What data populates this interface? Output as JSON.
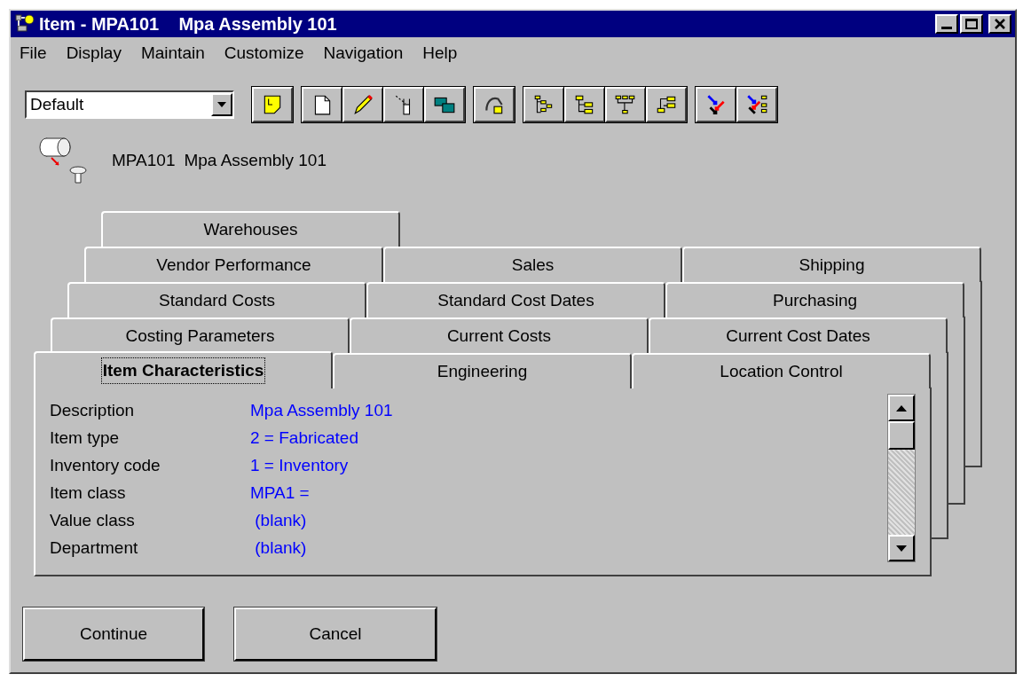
{
  "window": {
    "title": "Item - MPA101    Mpa Assembly 101"
  },
  "menu": [
    "File",
    "Display",
    "Maintain",
    "Customize",
    "Navigation",
    "Help"
  ],
  "view_select": {
    "value": "Default"
  },
  "item_header": {
    "code": "MPA101",
    "name": "Mpa Assembly 101"
  },
  "tab_rows": [
    [
      {
        "label": "Warehouses",
        "selected": false
      }
    ],
    [
      {
        "label": "Vendor Performance",
        "selected": false
      },
      {
        "label": "Sales",
        "selected": false
      },
      {
        "label": "Shipping",
        "selected": false
      }
    ],
    [
      {
        "label": "Standard Costs",
        "selected": false
      },
      {
        "label": "Standard Cost Dates",
        "selected": false
      },
      {
        "label": "Purchasing",
        "selected": false
      }
    ],
    [
      {
        "label": "Costing Parameters",
        "selected": false
      },
      {
        "label": "Current Costs",
        "selected": false
      },
      {
        "label": "Current Cost Dates",
        "selected": false
      }
    ],
    [
      {
        "label": "Item Characteristics",
        "selected": true
      },
      {
        "label": "Engineering",
        "selected": false
      },
      {
        "label": "Location Control",
        "selected": false
      }
    ]
  ],
  "fields": [
    {
      "label": "Description",
      "value": "Mpa Assembly 101"
    },
    {
      "label": "Item type",
      "value": "2 = Fabricated"
    },
    {
      "label": "Inventory code",
      "value": "1 = Inventory"
    },
    {
      "label": "Item class",
      "value": "MPA1 ="
    },
    {
      "label": "Value class",
      "value": " (blank)"
    },
    {
      "label": "Department",
      "value": " (blank)"
    }
  ],
  "buttons": [
    "Continue",
    "Cancel"
  ]
}
